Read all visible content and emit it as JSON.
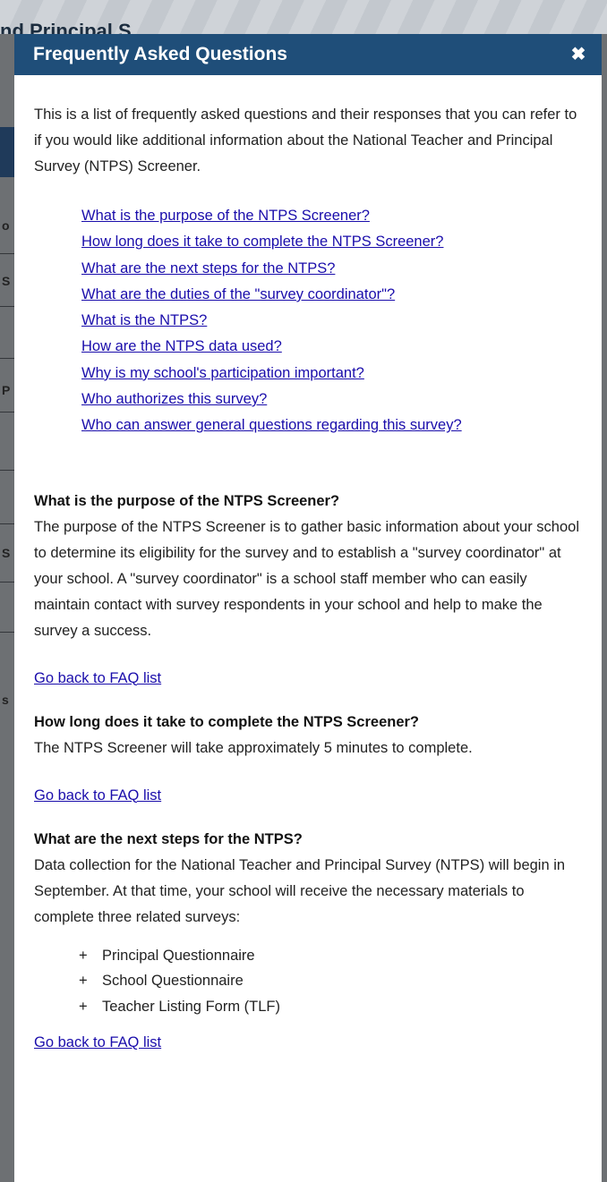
{
  "background": {
    "page_title_fragment": "nd Principal S",
    "side_chars": [
      "o",
      "S",
      "P",
      "S",
      "s"
    ]
  },
  "modal": {
    "title": "Frequently Asked Questions",
    "close_icon": "close-icon",
    "intro": "This is a list of frequently asked questions and their responses that you can refer to if you would like additional information about the National Teacher and Principal Survey (NTPS) Screener.",
    "toc": [
      "What is the purpose of the NTPS Screener?",
      "How long does it take to complete the NTPS Screener?",
      "What are the next steps for the NTPS?",
      "What are the duties of the \"survey coordinator\"?",
      "What is the NTPS?",
      "How are the NTPS data used?",
      "Why is my school's participation important?",
      "Who authorizes this survey?",
      "Who can answer general questions regarding this survey?"
    ],
    "sections": [
      {
        "question": "What is the purpose of the NTPS Screener?",
        "answer": "The purpose of the NTPS Screener is to gather basic information about your school to determine its eligibility for the survey and to establish a \"survey coordinator\" at your school. A \"survey coordinator\" is a school staff member who can easily maintain contact with survey respondents in your school and help to make the survey a success.",
        "back_label": "Go back to FAQ list"
      },
      {
        "question": "How long does it take to complete the NTPS Screener?",
        "answer": "The NTPS Screener will take approximately 5 minutes to complete.",
        "back_label": "Go back to FAQ list"
      },
      {
        "question": "What are the next steps for the NTPS?",
        "answer": "Data collection for the National Teacher and Principal Survey (NTPS) will begin in September. At that time, your school will receive the necessary materials to complete three related surveys:",
        "bullets": [
          "Principal Questionnaire",
          "School Questionnaire",
          "Teacher Listing Form (TLF)"
        ],
        "bullet_symbol": "+",
        "back_label": "Go back to FAQ list"
      }
    ]
  }
}
